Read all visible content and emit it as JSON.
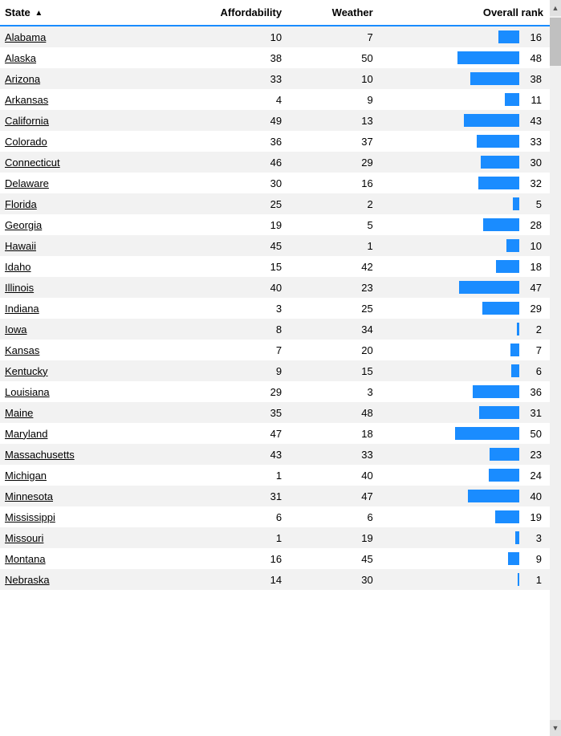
{
  "header": {
    "state_label": "State",
    "affordability_label": "Affordability",
    "weather_label": "Weather",
    "overall_rank_label": "Overall rank",
    "sort_arrow": "▲"
  },
  "rows": [
    {
      "state": "Alabama",
      "affordability": 10,
      "weather": 7,
      "rank": 16
    },
    {
      "state": "Alaska",
      "affordability": 38,
      "weather": 50,
      "rank": 48
    },
    {
      "state": "Arizona",
      "affordability": 33,
      "weather": 10,
      "rank": 38
    },
    {
      "state": "Arkansas",
      "affordability": 4,
      "weather": 9,
      "rank": 11
    },
    {
      "state": "California",
      "affordability": 49,
      "weather": 13,
      "rank": 43
    },
    {
      "state": "Colorado",
      "affordability": 36,
      "weather": 37,
      "rank": 33
    },
    {
      "state": "Connecticut",
      "affordability": 46,
      "weather": 29,
      "rank": 30
    },
    {
      "state": "Delaware",
      "affordability": 30,
      "weather": 16,
      "rank": 32
    },
    {
      "state": "Florida",
      "affordability": 25,
      "weather": 2,
      "rank": 5
    },
    {
      "state": "Georgia",
      "affordability": 19,
      "weather": 5,
      "rank": 28
    },
    {
      "state": "Hawaii",
      "affordability": 45,
      "weather": 1,
      "rank": 10
    },
    {
      "state": "Idaho",
      "affordability": 15,
      "weather": 42,
      "rank": 18
    },
    {
      "state": "Illinois",
      "affordability": 40,
      "weather": 23,
      "rank": 47
    },
    {
      "state": "Indiana",
      "affordability": 3,
      "weather": 25,
      "rank": 29
    },
    {
      "state": "Iowa",
      "affordability": 8,
      "weather": 34,
      "rank": 2
    },
    {
      "state": "Kansas",
      "affordability": 7,
      "weather": 20,
      "rank": 7
    },
    {
      "state": "Kentucky",
      "affordability": 9,
      "weather": 15,
      "rank": 6
    },
    {
      "state": "Louisiana",
      "affordability": 29,
      "weather": 3,
      "rank": 36
    },
    {
      "state": "Maine",
      "affordability": 35,
      "weather": 48,
      "rank": 31
    },
    {
      "state": "Maryland",
      "affordability": 47,
      "weather": 18,
      "rank": 50
    },
    {
      "state": "Massachusetts",
      "affordability": 43,
      "weather": 33,
      "rank": 23
    },
    {
      "state": "Michigan",
      "affordability": 1,
      "weather": 40,
      "rank": 24
    },
    {
      "state": "Minnesota",
      "affordability": 31,
      "weather": 47,
      "rank": 40
    },
    {
      "state": "Mississippi",
      "affordability": 6,
      "weather": 6,
      "rank": 19
    },
    {
      "state": "Missouri",
      "affordability": 1,
      "weather": 19,
      "rank": 3
    },
    {
      "state": "Montana",
      "affordability": 16,
      "weather": 45,
      "rank": 9
    },
    {
      "state": "Nebraska",
      "affordability": 14,
      "weather": 30,
      "rank": 1
    }
  ],
  "max_rank": 50,
  "bar_max_width": 80,
  "scrollbar": {
    "up_arrow": "▲",
    "down_arrow": "▼"
  }
}
